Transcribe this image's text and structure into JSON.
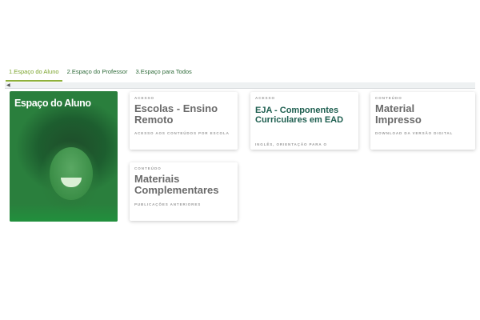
{
  "tabs": [
    {
      "label": "1.Espaço do Aluno",
      "active": true
    },
    {
      "label": "2.Espaço do Professor",
      "active": false
    },
    {
      "label": "3.Espaço para Todos",
      "active": false
    }
  ],
  "hero": {
    "title": "Espaço do Aluno"
  },
  "cards": [
    {
      "kicker": "ACESSO",
      "title": "Escolas - Ensino Remoto",
      "subtitle": "ACESSO AOS CONTEÚDOS POR ESCOLA"
    },
    {
      "kicker": "ACESSO",
      "title": "EJA - Componentes Curriculares em EAD",
      "subtitle": "INGLÊS, ORIENTAÇÃO PARA O"
    },
    {
      "kicker": "CONTEÚDO",
      "title": "Material Impresso",
      "subtitle": "DOWNLOAD DA VERSÃO DIGITAL"
    },
    {
      "kicker": "CONTEÚDO",
      "title": "Materiais Complementares",
      "subtitle": "PUBLICAÇÕES ANTERIORES"
    }
  ],
  "colors": {
    "accent": "#8fb13b",
    "tab_text": "#2f6b3a",
    "eja_title": "#1d5e4f",
    "card_title": "#6a6a6a"
  },
  "icons": {
    "scroll_left": "chevron-left-icon"
  }
}
